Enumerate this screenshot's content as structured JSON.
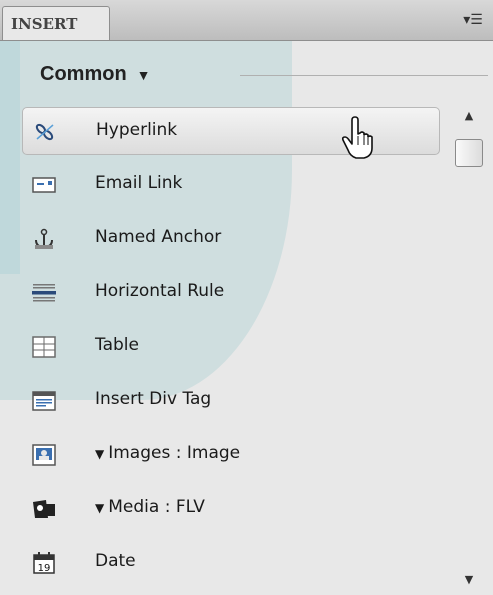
{
  "panel": {
    "tab_label": "INSERT",
    "menu_icon": "panel-options-icon"
  },
  "category": {
    "label": "Common",
    "dropdown_icon": "chevron-down-icon"
  },
  "items": [
    {
      "label": "Hyperlink",
      "icon": "hyperlink-icon",
      "hover": true
    },
    {
      "label": "Email Link",
      "icon": "email-link-icon"
    },
    {
      "label": "Named Anchor",
      "icon": "anchor-icon"
    },
    {
      "label": "Horizontal Rule",
      "icon": "horizontal-rule-icon"
    },
    {
      "label": "Table",
      "icon": "table-icon"
    },
    {
      "label": "Insert Div Tag",
      "icon": "div-tag-icon"
    },
    {
      "label": "Images : Image",
      "icon": "image-icon",
      "dropdown": true
    },
    {
      "label": "Media : FLV",
      "icon": "media-icon",
      "dropdown": true
    },
    {
      "label": "Date",
      "icon": "calendar-icon",
      "day": "19"
    }
  ],
  "scrollbar": {
    "up_icon": "scroll-up-icon",
    "down_icon": "scroll-down-icon"
  },
  "cursor": "hand-pointer-icon"
}
